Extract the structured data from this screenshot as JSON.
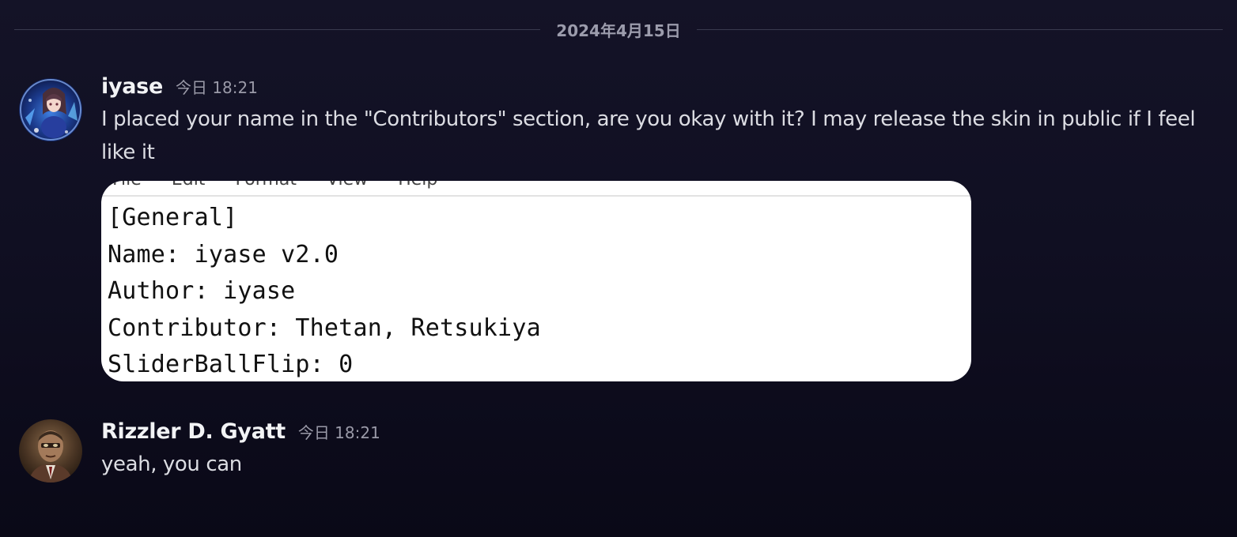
{
  "divider": {
    "date": "2024年4月15日"
  },
  "messages": [
    {
      "username": "iyase",
      "timestamp": "今日 18:21",
      "text": "I placed your name in the \"Contributors\" section, are you okay with it? I may release the skin in public if I feel like it",
      "attachment": {
        "menu": [
          "File",
          "Edit",
          "Format",
          "View",
          "Help"
        ],
        "lines": [
          "[General]",
          "Name: iyase v2.0",
          "Author: iyase",
          "Contributor: Thetan, Retsukiya",
          "SliderBallFlip: 0"
        ]
      }
    },
    {
      "username": "Rizzler D. Gyatt",
      "timestamp": "今日 18:21",
      "text": "yeah, you can"
    }
  ]
}
